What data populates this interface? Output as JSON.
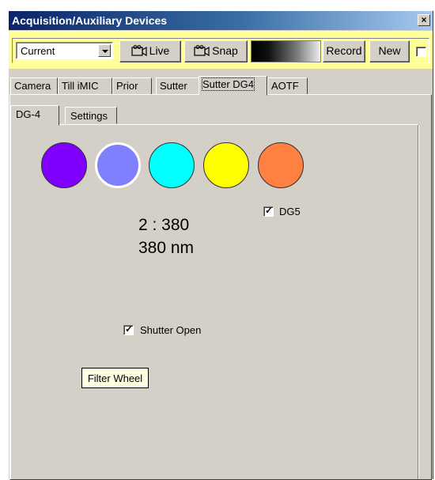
{
  "window": {
    "title": "Acquisition/Auxiliary Devices",
    "close_label": "×"
  },
  "toolbar": {
    "combo_value": "Current",
    "live_label": "Live",
    "snap_label": "Snap",
    "record_label": "Record",
    "new_label": "New",
    "right_checkbox_checked": false,
    "background_color": "#ffff99"
  },
  "device_tabs": [
    "Camera",
    "Till iMIC",
    "Prior",
    "Sutter",
    "Sutter DG4",
    "AOTF"
  ],
  "active_device_tab": "Sutter DG4",
  "sub_tabs": [
    "DG-4",
    "Settings"
  ],
  "active_sub_tab": "DG-4",
  "filters": [
    {
      "color": "#8000ff",
      "selected": false
    },
    {
      "color": "#8080ff",
      "selected": true
    },
    {
      "color": "#00ffff",
      "selected": false
    },
    {
      "color": "#ffff00",
      "selected": false
    },
    {
      "color": "#ff8040",
      "selected": false
    }
  ],
  "dg5": {
    "label": "DG5",
    "checked": true
  },
  "readout": {
    "position_text": "2 : 380",
    "wavelength_text": "380 nm"
  },
  "shutter": {
    "label": "Shutter Open",
    "checked": true
  },
  "filter_wheel_label": "Filter Wheel"
}
